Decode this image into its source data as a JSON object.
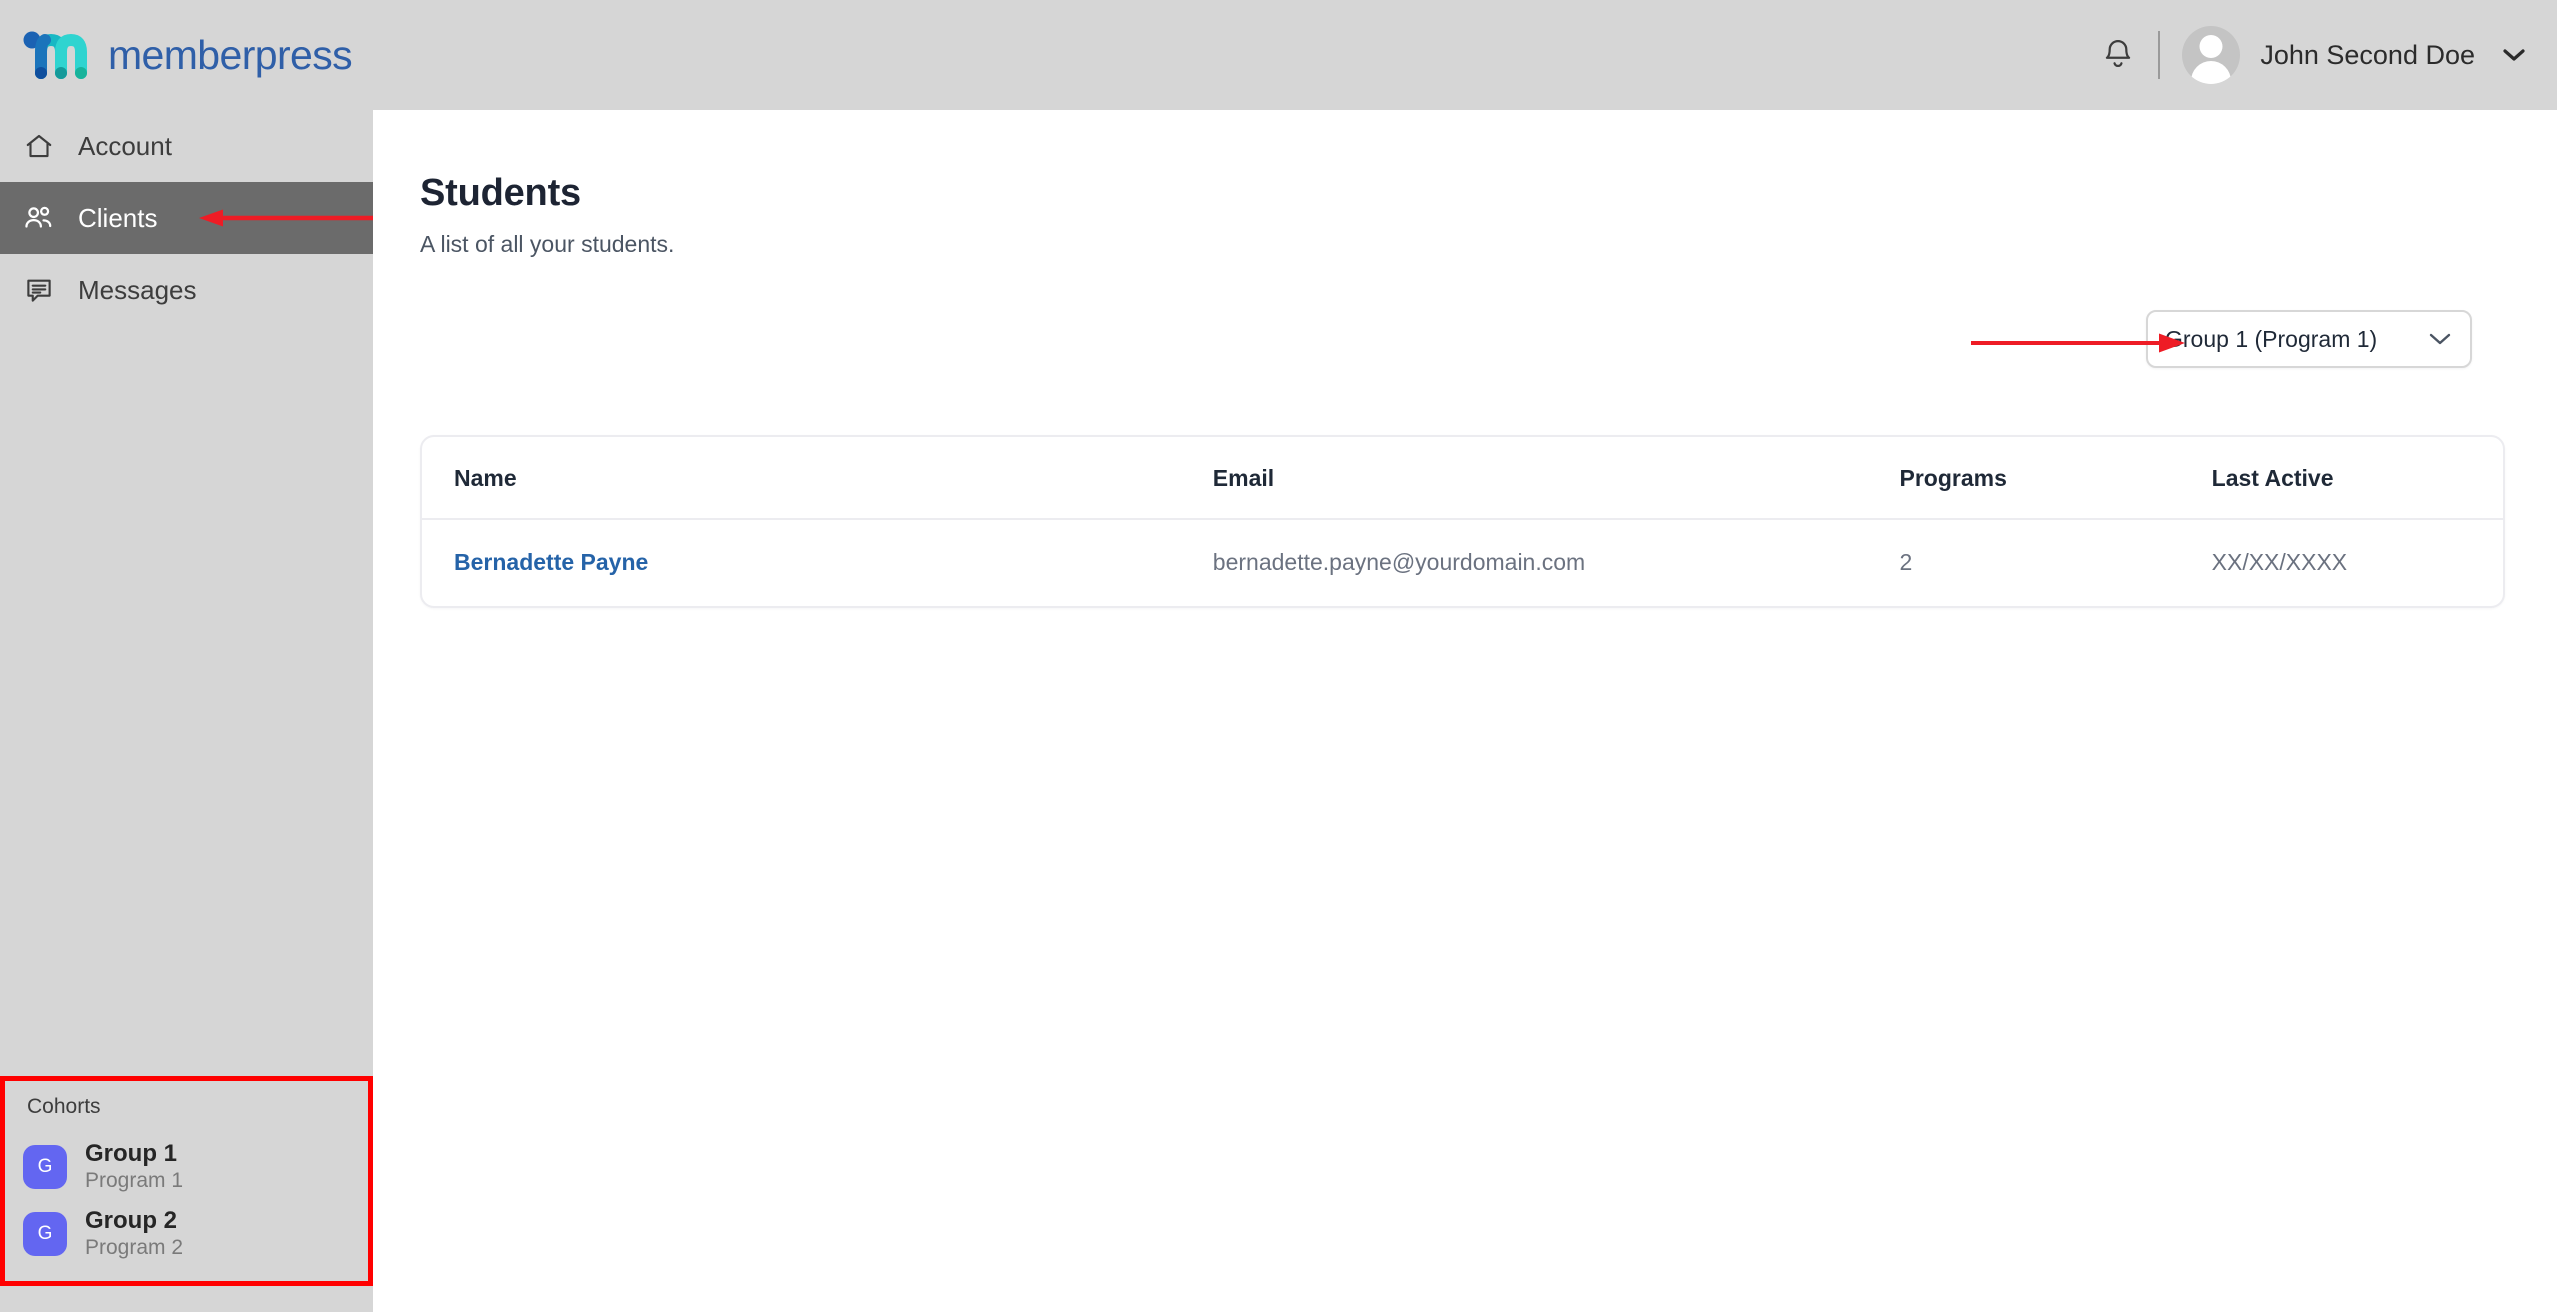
{
  "brand": {
    "word": "memberpress",
    "logo_icon": "memberpress-m-logo",
    "colors": {
      "word": "#2f5fa8",
      "stroke_blue": "#1b74bb",
      "stroke_teal": "#18b8b8",
      "stroke_cyan": "#2fd2d2"
    }
  },
  "topbar": {
    "bell_icon": "bell-icon",
    "avatar_icon": "user-avatar-icon",
    "username": "John Second Doe",
    "caret_icon": "chevron-down-icon",
    "background": "#d6d6d6"
  },
  "sidebar": {
    "background": "#d6d6d6",
    "active_background": "#6b6b6b",
    "items": [
      {
        "label": "Account",
        "icon": "home-icon",
        "active": false
      },
      {
        "label": "Clients",
        "icon": "users-icon",
        "active": true
      },
      {
        "label": "Messages",
        "icon": "chat-bubble-icon",
        "active": false
      }
    ],
    "cohorts": {
      "label": "Cohorts",
      "highlight_color": "#ff0000",
      "badge_color": "#6366f1",
      "items": [
        {
          "badge": "G",
          "name": "Group 1",
          "program": "Program 1"
        },
        {
          "badge": "G",
          "name": "Group 2",
          "program": "Program 2"
        }
      ]
    }
  },
  "main": {
    "title": "Students",
    "subtitle": "A list of all your students.",
    "group_select": {
      "value": "Group 1 (Program 1)",
      "caret_icon": "chevron-down-icon",
      "annotation_arrow": "red-arrow-pointing-right"
    },
    "table": {
      "columns": [
        "Name",
        "Email",
        "Programs",
        "Last Active"
      ],
      "rows": [
        {
          "name": "Bernadette Payne",
          "email": "bernadette.payne@yourdomain.com",
          "programs": "2",
          "last_active": "XX/XX/XXXX"
        }
      ]
    }
  },
  "annotations": {
    "clients_arrow": "red-arrow-pointing-left-at-clients",
    "arrow_color": "#ee1c25"
  }
}
